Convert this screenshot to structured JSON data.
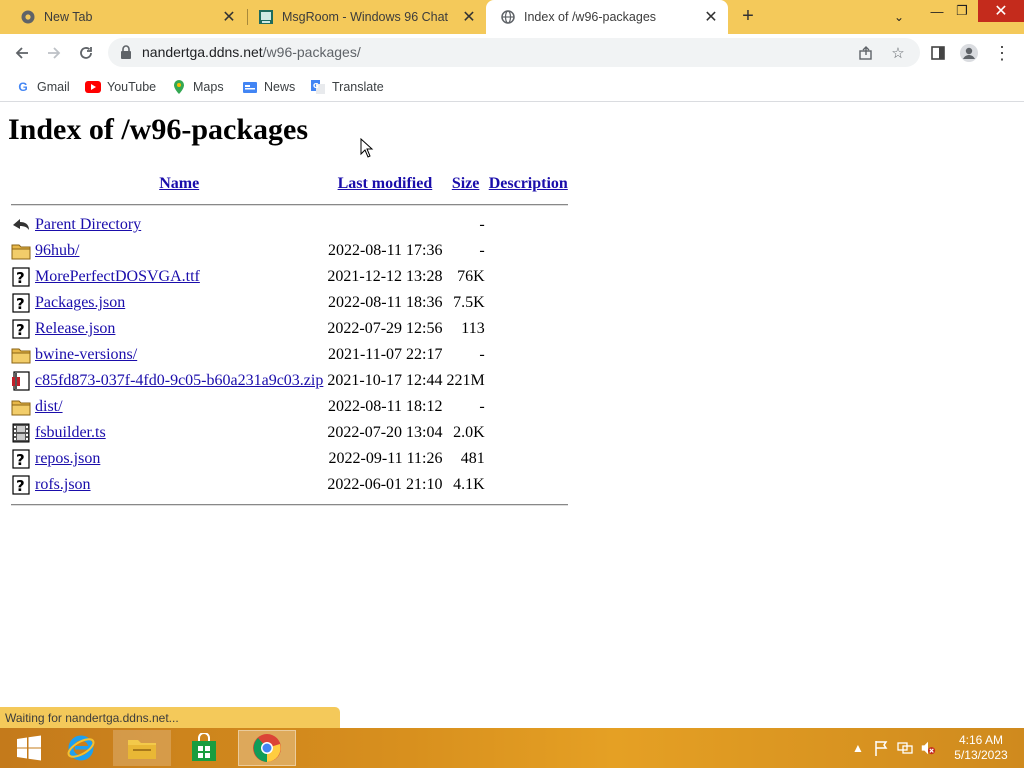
{
  "browser": {
    "tabs": [
      {
        "title": "New Tab",
        "icon": "chrome-icon",
        "active": false
      },
      {
        "title": "MsgRoom - Windows 96 Chat",
        "icon": "msgroom-icon",
        "active": false
      },
      {
        "title": "Index of /w96-packages",
        "icon": "globe-icon",
        "active": true
      }
    ],
    "address": {
      "host": "nandertga.ddns.net",
      "path": "/w96-packages/"
    },
    "bookmarks": [
      {
        "label": "Gmail",
        "icon": "google-icon"
      },
      {
        "label": "YouTube",
        "icon": "youtube-icon"
      },
      {
        "label": "Maps",
        "icon": "maps-icon"
      },
      {
        "label": "News",
        "icon": "news-icon"
      },
      {
        "label": "Translate",
        "icon": "translate-icon"
      }
    ],
    "status_text": "Waiting for nandertga.ddns.net..."
  },
  "page": {
    "heading": "Index of /w96-packages",
    "columns": {
      "name": "Name",
      "modified": "Last modified",
      "size": "Size",
      "description": "Description"
    },
    "entries": [
      {
        "type": "back",
        "name": "Parent Directory",
        "modified": "",
        "size": "-"
      },
      {
        "type": "folder",
        "name": "96hub/",
        "modified": "2022-08-11 17:36",
        "size": "-"
      },
      {
        "type": "unknown",
        "name": "MorePerfectDOSVGA.ttf",
        "modified": "2021-12-12 13:28",
        "size": "76K"
      },
      {
        "type": "unknown",
        "name": "Packages.json",
        "modified": "2022-08-11 18:36",
        "size": "7.5K"
      },
      {
        "type": "unknown",
        "name": "Release.json",
        "modified": "2022-07-29 12:56",
        "size": "113"
      },
      {
        "type": "folder",
        "name": "bwine-versions/",
        "modified": "2021-11-07 22:17",
        "size": "-"
      },
      {
        "type": "compressed",
        "name": "c85fd873-037f-4fd0-9c05-b60a231a9c03.zip",
        "modified": "2021-10-17 12:44",
        "size": "221M"
      },
      {
        "type": "folder",
        "name": "dist/",
        "modified": "2022-08-11 18:12",
        "size": "-"
      },
      {
        "type": "video",
        "name": "fsbuilder.ts",
        "modified": "2022-07-20 13:04",
        "size": "2.0K"
      },
      {
        "type": "unknown",
        "name": "repos.json",
        "modified": "2022-09-11 11:26",
        "size": "481"
      },
      {
        "type": "unknown",
        "name": "rofs.json",
        "modified": "2022-06-01 21:10",
        "size": "4.1K"
      }
    ]
  },
  "taskbar": {
    "apps": [
      "start-button",
      "internet-explorer",
      "file-explorer",
      "store",
      "chrome"
    ],
    "clock_time": "4:16 AM",
    "clock_date": "5/13/2023"
  },
  "colors": {
    "tabstrip": "#f4c95a",
    "link": "#1a0dab",
    "close_button": "#c42b1c"
  }
}
